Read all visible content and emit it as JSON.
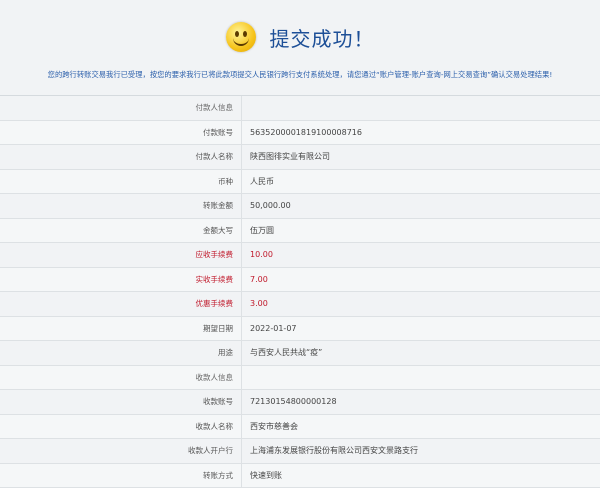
{
  "header": {
    "title": "提交成功！",
    "notice": "您的跨行转账交易我行已受理，按您的要求我行已将此款项提交人民银行跨行支付系统处理，请您通过“账户管理-账户查询-网上交易查询”确认交易处理结果!"
  },
  "rows": [
    {
      "label": "付款人信息",
      "value": "",
      "section": true
    },
    {
      "label": "付款账号",
      "value": "5635200001819100008716"
    },
    {
      "label": "付款人名称",
      "value": "陕西图徘实业有限公司"
    },
    {
      "label": "币种",
      "value": "人民币"
    },
    {
      "label": "转账金额",
      "value": "50,000.00"
    },
    {
      "label": "金额大写",
      "value": "伍万圆"
    },
    {
      "label": "应收手续费",
      "value": "10.00",
      "red": true
    },
    {
      "label": "实收手续费",
      "value": "7.00",
      "red": true
    },
    {
      "label": "优惠手续费",
      "value": "3.00",
      "red": true
    },
    {
      "label": "期望日期",
      "value": "2022-01-07"
    },
    {
      "label": "用途",
      "value": "与西安人民共战“疫”"
    },
    {
      "label": "收款人信息",
      "value": "",
      "section": true
    },
    {
      "label": "收款账号",
      "value": "72130154800000128"
    },
    {
      "label": "收款人名称",
      "value": "西安市慈善会"
    },
    {
      "label": "收款人开户行",
      "value": "上海浦东发展银行股份有限公司西安文景路支行"
    },
    {
      "label": "转账方式",
      "value": "快速到账"
    }
  ],
  "colors": {
    "title": "#1d4f97",
    "notice": "#2b5fab",
    "red_label": "#c0182a"
  },
  "icons": {
    "status": "smiley-icon"
  }
}
